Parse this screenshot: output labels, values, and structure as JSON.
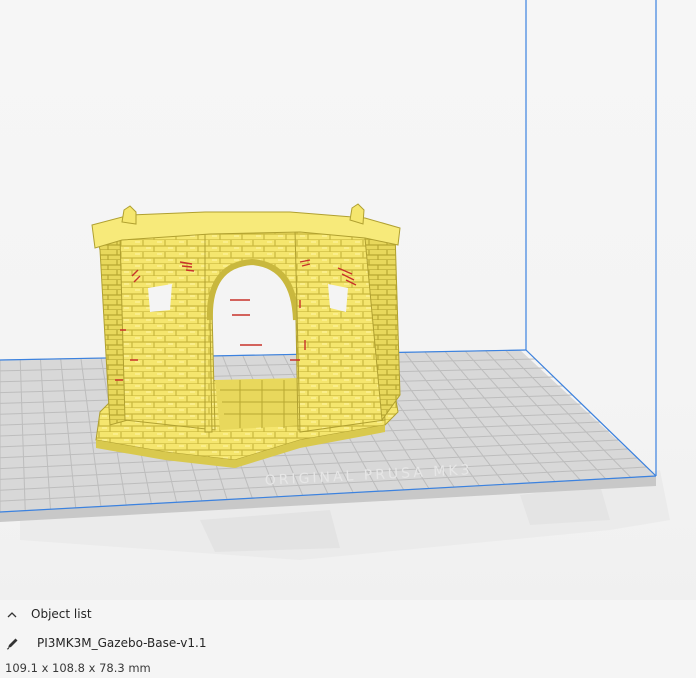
{
  "viewport": {
    "bed_label": "ORIGINAL PRUSA MK3",
    "colors": {
      "model_yellow": "#f5e66e",
      "model_shadow": "#c9b83e",
      "overhang_red": "#c8322a",
      "volume_line": "#3b82e0",
      "bed_fill": "#d5d5d5",
      "grid_line": "#bdbdbd"
    }
  },
  "object_list": {
    "toggle_icon": "chevron-up-icon",
    "title": "Object list"
  },
  "object": {
    "edit_icon": "pencil-icon",
    "name": "PI3MK3M_Gazebo-Base-v1.1",
    "dimensions": "109.1 x 108.8 x 78.3 mm"
  }
}
